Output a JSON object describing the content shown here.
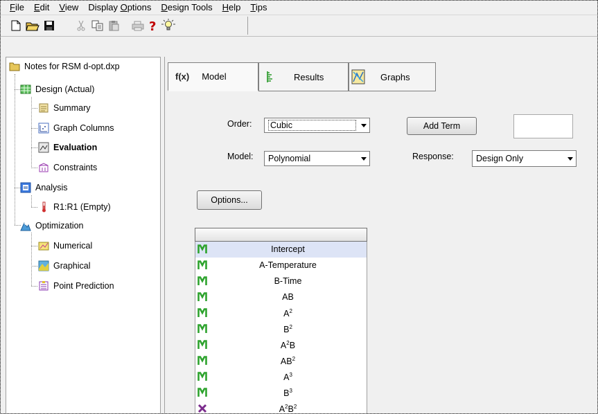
{
  "menu": {
    "items": [
      {
        "label": "File",
        "u": "F"
      },
      {
        "label": "Edit",
        "u": "E"
      },
      {
        "label": "View",
        "u": "V"
      },
      {
        "label": "Display Options",
        "u": "O"
      },
      {
        "label": "Design Tools",
        "u": "D"
      },
      {
        "label": "Help",
        "u": "H"
      },
      {
        "label": "Tips",
        "u": "T"
      }
    ]
  },
  "tree": {
    "root": "Notes for RSM d-opt.dxp",
    "design": "Design (Actual)",
    "summary": "Summary",
    "graph_columns": "Graph Columns",
    "evaluation": "Evaluation",
    "constraints": "Constraints",
    "analysis": "Analysis",
    "r1": "R1:R1 (Empty)",
    "optimization": "Optimization",
    "numerical": "Numerical",
    "graphical": "Graphical",
    "point_prediction": "Point Prediction"
  },
  "tabs": {
    "model": {
      "icon_text": "f(x)",
      "label": "Model"
    },
    "results": {
      "label": "Results"
    },
    "graphs": {
      "label": "Graphs"
    }
  },
  "form": {
    "order_label": "Order:",
    "order_value": "Cubic",
    "model_label": "Model:",
    "model_value": "Polynomial",
    "add_term": "Add Term",
    "add_term_value": "",
    "response_label": "Response:",
    "response_value": "Design Only",
    "options": "Options..."
  },
  "terms": [
    {
      "base": "Intercept",
      "sup": "",
      "base2": "",
      "sup2": "",
      "status": "M"
    },
    {
      "base": "A-Temperature",
      "sup": "",
      "base2": "",
      "sup2": "",
      "status": "M"
    },
    {
      "base": "B-Time",
      "sup": "",
      "base2": "",
      "sup2": "",
      "status": "M"
    },
    {
      "base": "AB",
      "sup": "",
      "base2": "",
      "sup2": "",
      "status": "M"
    },
    {
      "base": "A",
      "sup": "2",
      "base2": "",
      "sup2": "",
      "status": "M"
    },
    {
      "base": "B",
      "sup": "2",
      "base2": "",
      "sup2": "",
      "status": "M"
    },
    {
      "base": "A",
      "sup": "2",
      "base2": "B",
      "sup2": "",
      "status": "M"
    },
    {
      "base": "AB",
      "sup": "2",
      "base2": "",
      "sup2": "",
      "status": "M"
    },
    {
      "base": "A",
      "sup": "3",
      "base2": "",
      "sup2": "",
      "status": "M"
    },
    {
      "base": "B",
      "sup": "3",
      "base2": "",
      "sup2": "",
      "status": "M"
    },
    {
      "base": "A",
      "sup": "2",
      "base2": "B",
      "sup2": "2",
      "status": "X"
    }
  ],
  "colors": {
    "model_mark": "#2ea32e",
    "excluded_mark": "#7b2c8c",
    "selected_row": "#dde4f6"
  }
}
